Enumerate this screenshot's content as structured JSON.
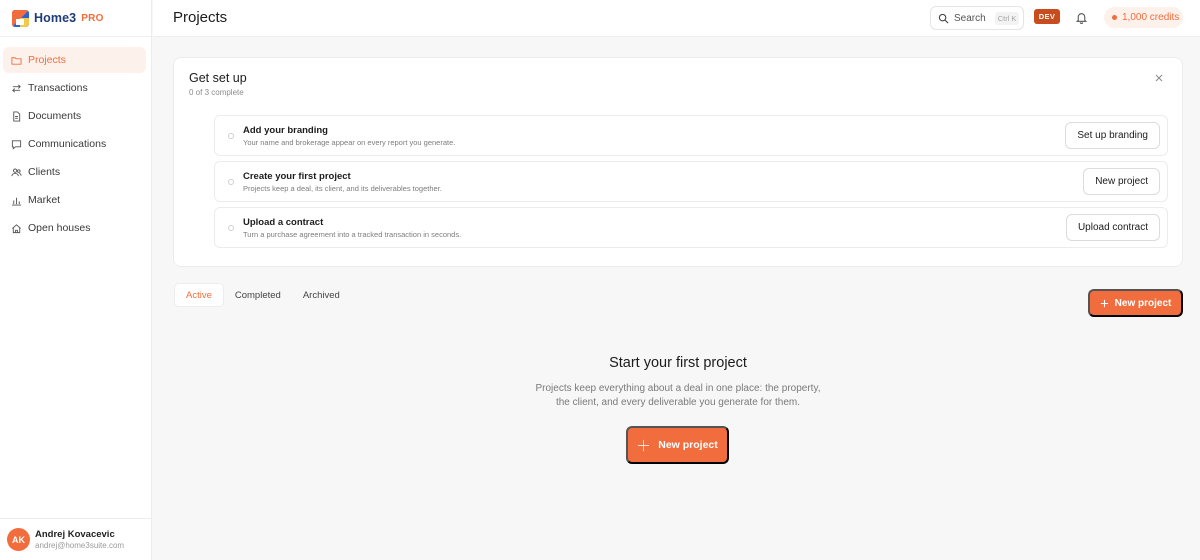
{
  "brand": {
    "name": "Home3",
    "tier": "PRO"
  },
  "sidebar": {
    "items": [
      {
        "label": "Projects",
        "icon": "folder-icon",
        "active": true
      },
      {
        "label": "Transactions",
        "icon": "swap-arrows-icon"
      },
      {
        "label": "Documents",
        "icon": "document-icon"
      },
      {
        "label": "Communications",
        "icon": "chat-bubble-icon"
      },
      {
        "label": "Clients",
        "icon": "users-icon"
      },
      {
        "label": "Market",
        "icon": "bar-chart-icon"
      },
      {
        "label": "Open houses",
        "icon": "house-icon"
      }
    ]
  },
  "user": {
    "initials": "AK",
    "name": "Andrej Kovacevic",
    "email": "andrej@home3suite.com"
  },
  "header": {
    "title": "Projects",
    "search_label": "Search",
    "search_shortcut": "Ctrl K",
    "env_badge": "DEV",
    "credits": "1,000 credits"
  },
  "setup": {
    "title": "Get set up",
    "progress": "0 of 3 complete",
    "steps": [
      {
        "title": "Add your branding",
        "desc": "Your name and brokerage appear on every report you generate.",
        "button": "Set up branding"
      },
      {
        "title": "Create your first project",
        "desc": "Projects keep a deal, its client, and its deliverables together.",
        "button": "New project"
      },
      {
        "title": "Upload a contract",
        "desc": "Turn a purchase agreement into a tracked transaction in seconds.",
        "button": "Upload contract"
      }
    ]
  },
  "tabs": [
    {
      "label": "Active",
      "active": true
    },
    {
      "label": "Completed"
    },
    {
      "label": "Archived"
    }
  ],
  "actions": {
    "new_project": "New project"
  },
  "empty_state": {
    "title": "Start your first project",
    "description": "Projects keep everything about a deal in one place: the property, the client, and every deliverable you generate for them.",
    "button": "New project"
  },
  "colors": {
    "accent": "#f26d3d",
    "dev_badge": "#c94c1e",
    "brand_text": "#1f3b7a"
  }
}
